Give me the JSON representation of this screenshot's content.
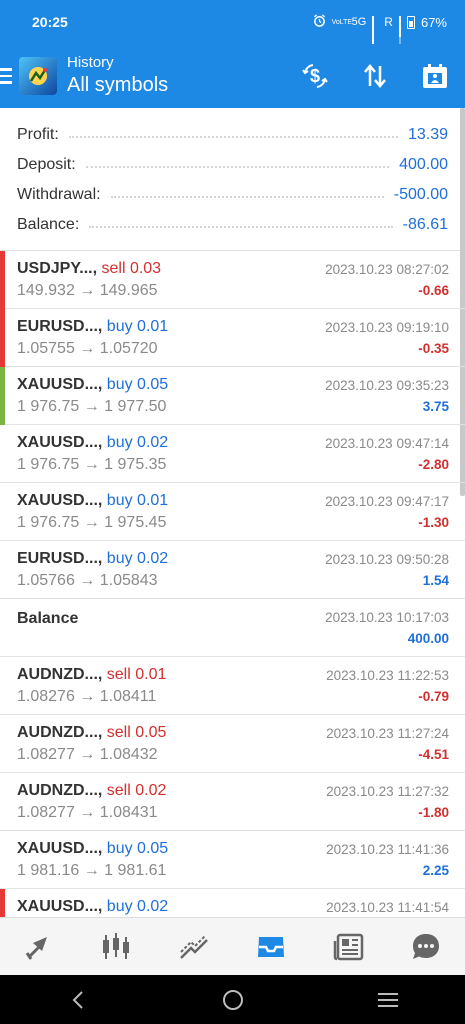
{
  "status_bar": {
    "time": "20:25",
    "network": "5G",
    "roaming": "R",
    "battery": "67%",
    "volte": "VoLTE"
  },
  "app_bar": {
    "subtitle": "History",
    "title": "All symbols"
  },
  "summary": [
    {
      "label": "Profit:",
      "value": "13.39"
    },
    {
      "label": "Deposit:",
      "value": "400.00"
    },
    {
      "label": "Withdrawal:",
      "value": "-500.00"
    },
    {
      "label": "Balance:",
      "value": "-86.61"
    }
  ],
  "deals": [
    {
      "symbol": "USDJPY...,",
      "side": "sell 0.03",
      "type": "sell",
      "prices": "149.932 → 149.965",
      "time": "2023.10.23 08:27:02",
      "profit": "-0.66",
      "sign": "neg",
      "marker": "#e53935"
    },
    {
      "symbol": "EURUSD...,",
      "side": "buy 0.01",
      "type": "buy",
      "prices": "1.05755 → 1.05720",
      "time": "2023.10.23 09:19:10",
      "profit": "-0.35",
      "sign": "neg",
      "marker": "#e53935"
    },
    {
      "symbol": "XAUUSD...,",
      "side": "buy 0.05",
      "type": "buy",
      "prices": "1 976.75 → 1 977.50",
      "time": "2023.10.23 09:35:23",
      "profit": "3.75",
      "sign": "pos",
      "marker": "#7cb342"
    },
    {
      "symbol": "XAUUSD...,",
      "side": "buy 0.02",
      "type": "buy",
      "prices": "1 976.75 → 1 975.35",
      "time": "2023.10.23 09:47:14",
      "profit": "-2.80",
      "sign": "neg",
      "marker": ""
    },
    {
      "symbol": "XAUUSD...,",
      "side": "buy 0.01",
      "type": "buy",
      "prices": "1 976.75 → 1 975.45",
      "time": "2023.10.23 09:47:17",
      "profit": "-1.30",
      "sign": "neg",
      "marker": ""
    },
    {
      "symbol": "EURUSD...,",
      "side": "buy 0.02",
      "type": "buy",
      "prices": "1.05766 → 1.05843",
      "time": "2023.10.23 09:50:28",
      "profit": "1.54",
      "sign": "pos",
      "marker": ""
    },
    {
      "symbol": "Balance",
      "side": "",
      "type": "balance",
      "prices": "",
      "time": "2023.10.23 10:17:03",
      "profit": "400.00",
      "sign": "pos",
      "marker": ""
    },
    {
      "symbol": "AUDNZD...,",
      "side": "sell 0.01",
      "type": "sell",
      "prices": "1.08276 → 1.08411",
      "time": "2023.10.23 11:22:53",
      "profit": "-0.79",
      "sign": "neg",
      "marker": ""
    },
    {
      "symbol": "AUDNZD...,",
      "side": "sell 0.05",
      "type": "sell",
      "prices": "1.08277 → 1.08432",
      "time": "2023.10.23 11:27:24",
      "profit": "-4.51",
      "sign": "neg",
      "marker": ""
    },
    {
      "symbol": "AUDNZD...,",
      "side": "sell 0.02",
      "type": "sell",
      "prices": "1.08277 → 1.08431",
      "time": "2023.10.23 11:27:32",
      "profit": "-1.80",
      "sign": "neg",
      "marker": ""
    },
    {
      "symbol": "XAUUSD...,",
      "side": "buy 0.05",
      "type": "buy",
      "prices": "1 981.16 → 1 981.61",
      "time": "2023.10.23 11:41:36",
      "profit": "2.25",
      "sign": "pos",
      "marker": ""
    },
    {
      "symbol": "XAUUSD...,",
      "side": "buy 0.02",
      "type": "buy",
      "prices": "",
      "time": "2023.10.23 11:41:54",
      "profit": "",
      "sign": "neg",
      "marker": "#e53935"
    }
  ],
  "bottom_nav": [
    {
      "name": "nav-quotes",
      "icon": "arrows-updown-icon"
    },
    {
      "name": "nav-chart",
      "icon": "candlestick-icon"
    },
    {
      "name": "nav-trade",
      "icon": "trend-icon"
    },
    {
      "name": "nav-history",
      "icon": "inbox-icon",
      "active": true
    },
    {
      "name": "nav-news",
      "icon": "newspaper-icon"
    },
    {
      "name": "nav-messages",
      "icon": "chat-icon"
    }
  ],
  "colors": {
    "primary": "#1e88e5",
    "buy": "#1e6fd9",
    "sell": "#d32f2f",
    "profit_positive": "#1e6fd9",
    "profit_negative": "#d32f2f"
  }
}
